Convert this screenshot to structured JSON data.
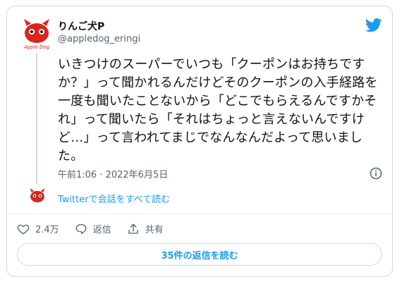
{
  "tweet": {
    "author_name": "りんご犬P",
    "handle": "@appledog_eringi",
    "avatar_text": "Apple Dog",
    "text": "いきつけのスーパーでいつも「クーポンはお持ちですか？」って聞かれるんだけどそのクーポンの入手経路を一度も聞いたことないから「どこでもらえるんですかそれ」って聞いたら「それはちょっと言えないんですけど…」って言われてまじでなんなんだよって思いました。",
    "timestamp": "午前1:06 · 2022年6月5日",
    "read_conversation": "Twitterで会話をすべて読む",
    "actions": {
      "likes": "2.4万",
      "reply": "返信",
      "share": "共有"
    },
    "read_replies": "35件の返信を読む"
  },
  "colors": {
    "accent": "#1d9bf0",
    "text": "#0f1419",
    "muted": "#536471",
    "avatar_red": "#d7261e"
  }
}
